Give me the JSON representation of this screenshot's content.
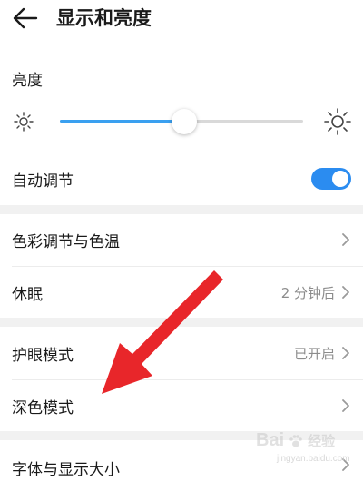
{
  "header": {
    "title": "显示和亮度",
    "back_icon": "arrow-left-icon"
  },
  "brightness": {
    "label": "亮度",
    "level": 0.51,
    "min_icon": "sun-small-icon",
    "max_icon": "sun-large-icon"
  },
  "auto_adjust": {
    "label": "自动调节",
    "enabled": true
  },
  "settings": [
    {
      "label": "色彩调节与色温",
      "value": ""
    },
    {
      "label": "休眠",
      "value": "2 分钟后"
    },
    {
      "label": "护眼模式",
      "value": "已开启"
    },
    {
      "label": "深色模式",
      "value": ""
    },
    {
      "label": "字体与显示大小",
      "value": ""
    }
  ],
  "annotation": {
    "arrow_color": "#e8262a"
  },
  "watermark": {
    "text": "Bai",
    "sub": "经验",
    "url": "jingyan.baidu.com"
  },
  "colors": {
    "accent": "#2b8cf0",
    "slider_fill": "#3aa0f0",
    "section_gap": "#f1f1f1"
  }
}
